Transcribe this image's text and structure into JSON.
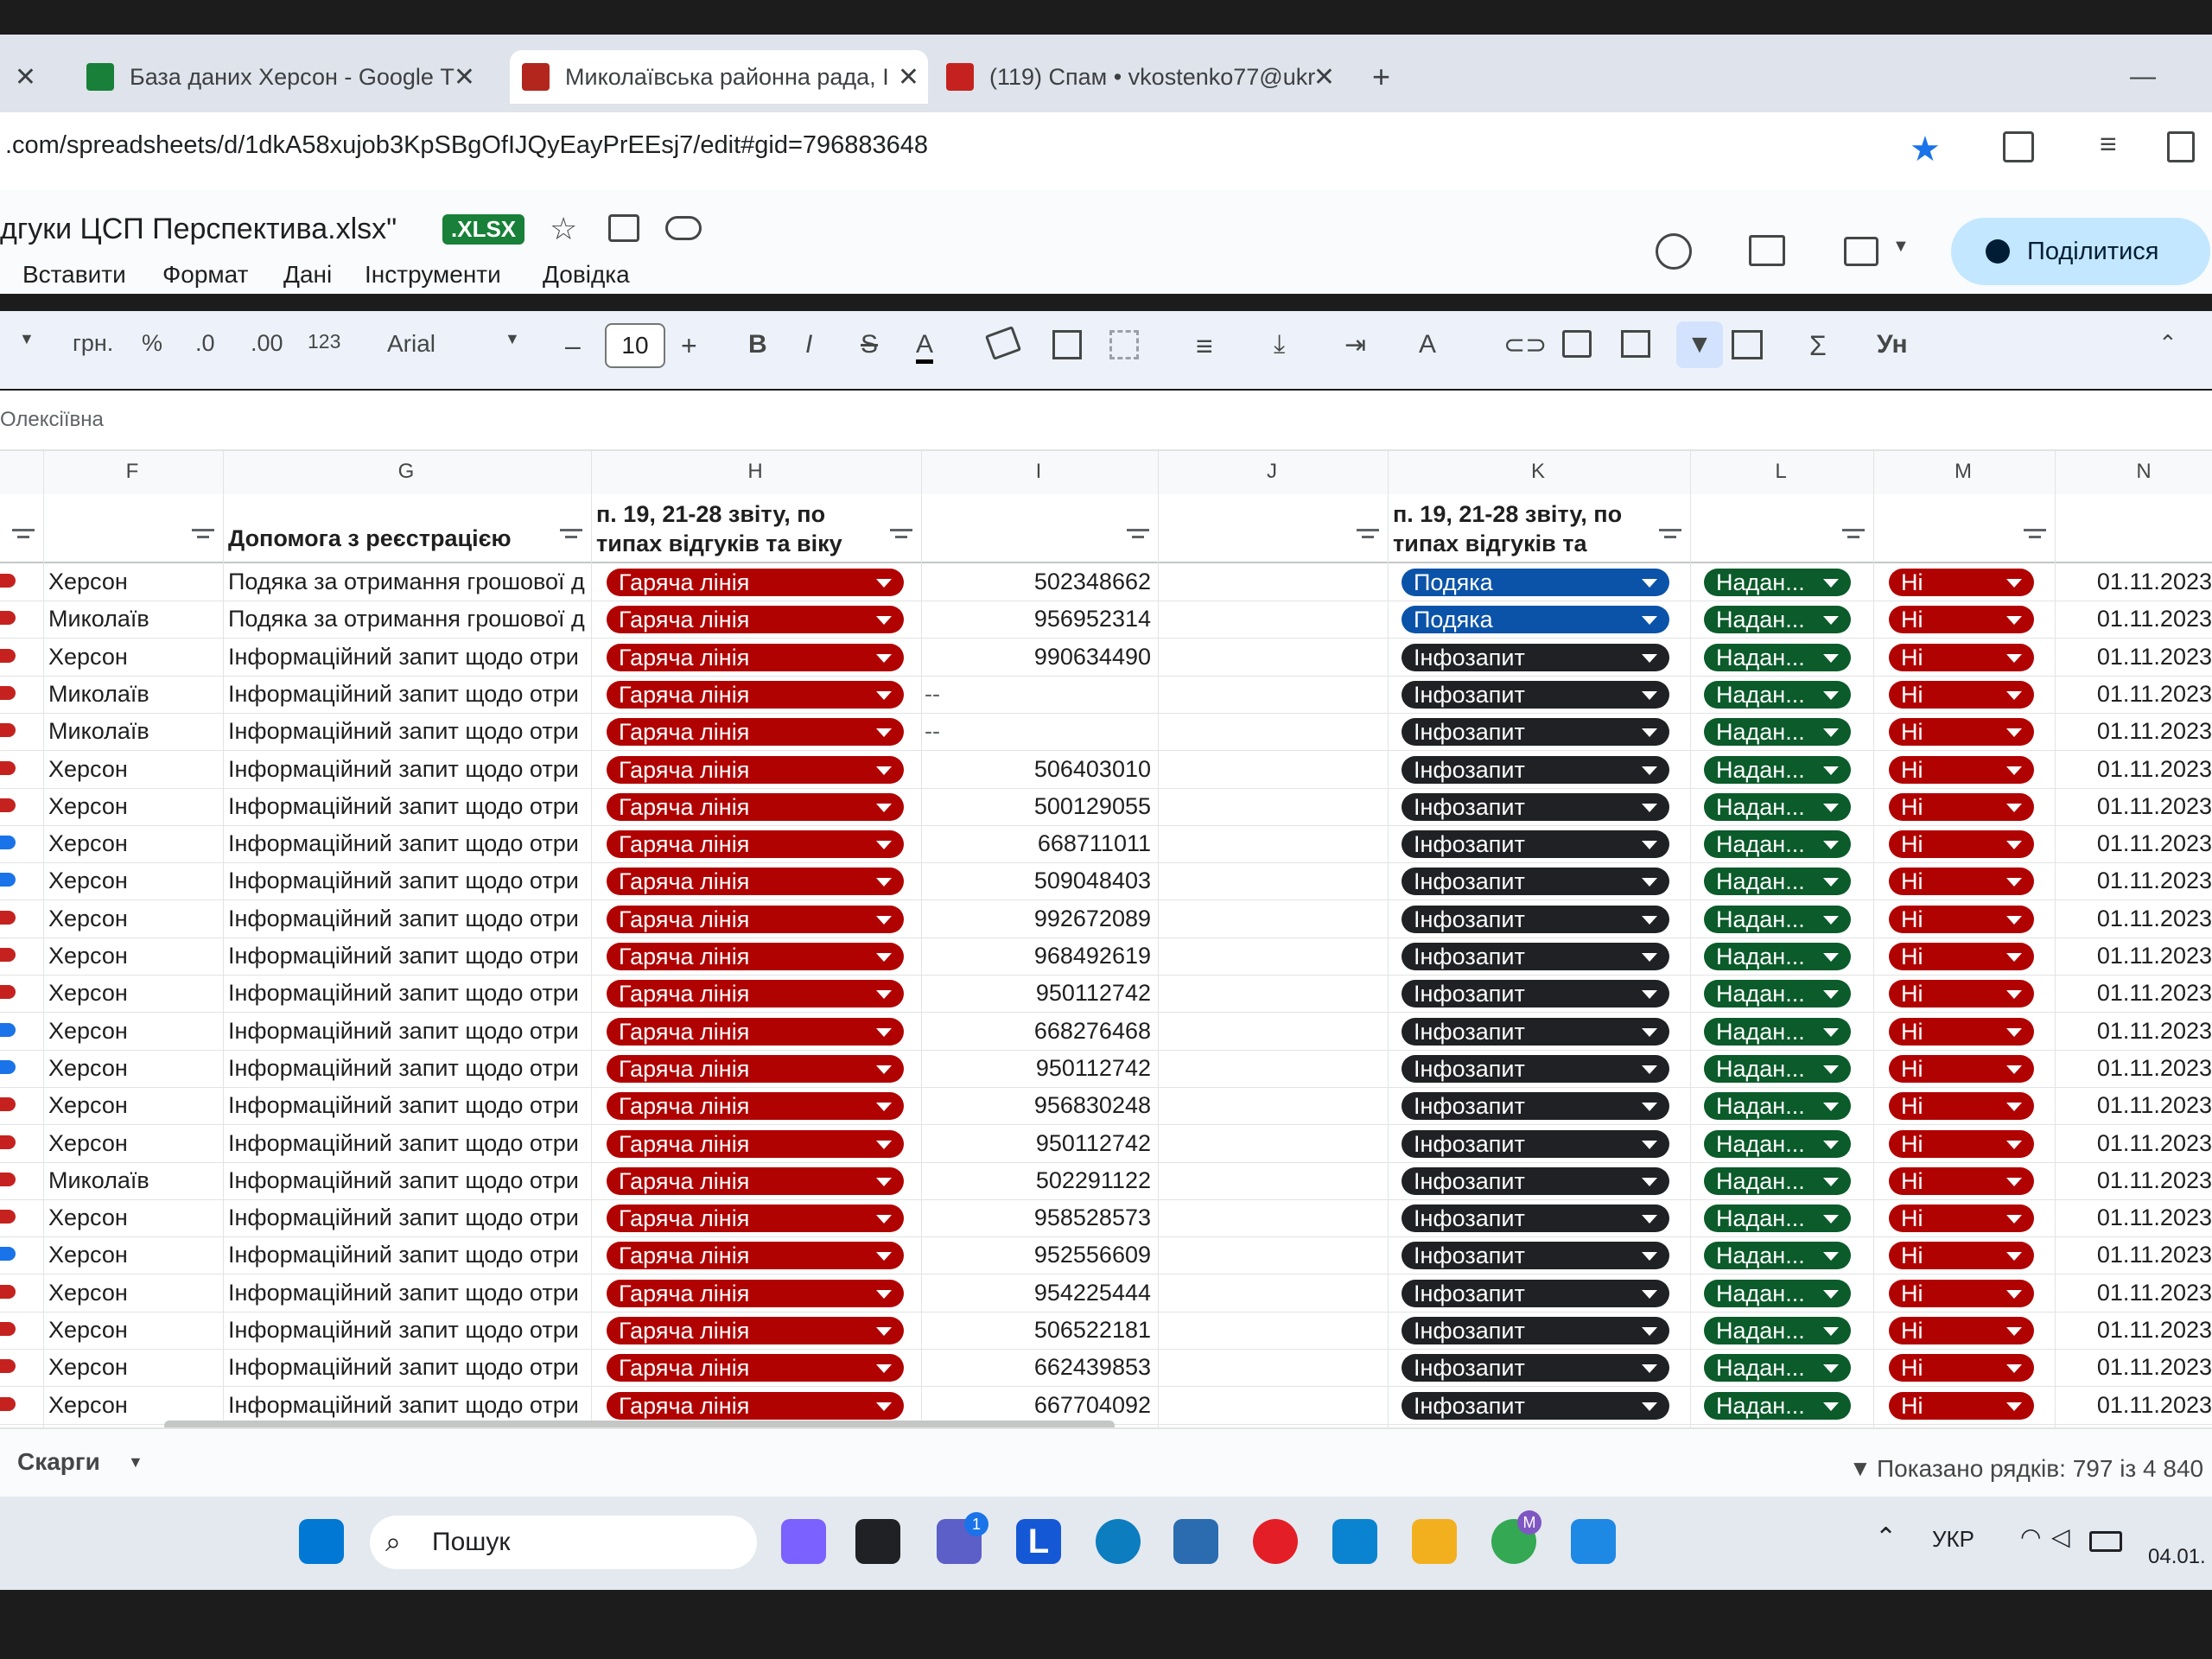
{
  "browser": {
    "tabs": [
      {
        "label": "База даних Херсон - Google Т",
        "favicon_color": "#188038"
      },
      {
        "label": "Миколаївська районна рада, І",
        "favicon_color": "#b3261e"
      },
      {
        "label": "(119) Спам • vkostenko77@ukr",
        "favicon_color": "#c5221f"
      }
    ],
    "new_tab": "+",
    "url": ".com/spreadsheets/d/1dkA58xujob3KpSBgOfIJQyEayPrEEsj7/edit#gid=796883648"
  },
  "doc": {
    "title": "дгуки ЦСП Перспектива.xlsx\"",
    "badge": ".XLSX",
    "menus": [
      "Вставити",
      "Формат",
      "Дані",
      "Інструменти",
      "Довідка"
    ],
    "share_label": "Поділитися"
  },
  "toolbar": {
    "currency": "грн.",
    "percent": "%",
    "dec_minus": ".0",
    "dec_plus": ".00",
    "number_fmt": "123",
    "font": "Arial",
    "font_size": "10",
    "minus": "–",
    "plus": "+",
    "bold": "B",
    "italic": "I",
    "strike": "S",
    "textcolor": "A",
    "sigma": "Σ",
    "input_tool": "Ун"
  },
  "formula_bar": {
    "value": "Олексіївна"
  },
  "columns": [
    "F",
    "G",
    "H",
    "I",
    "J",
    "K",
    "L",
    "M",
    "N"
  ],
  "header": {
    "g": "Допомога з реєстрацією",
    "h_line1": "п. 19, 21-28 звіту, по",
    "h_line2": "типах відгуків та віку",
    "k_line1": "п. 19, 21-28 звіту, по",
    "k_line2": "типах відгуків та"
  },
  "rows": [
    {
      "f": "Херсон",
      "g": "Подяка за отримання грошової д",
      "h": "Гаряча лінія",
      "i": "502348662",
      "j": "",
      "k": "Подяка",
      "k_color": "blue",
      "l": "Надан...",
      "m": "Ні",
      "n": "01.11.2023",
      "tag": "#c5221f"
    },
    {
      "f": "Миколаїв",
      "g": "Подяка за отримання грошової д",
      "h": "Гаряча лінія",
      "i": "956952314",
      "j": "",
      "k": "Подяка",
      "k_color": "blue",
      "l": "Надан...",
      "m": "Ні",
      "n": "01.11.2023",
      "tag": "#c5221f"
    },
    {
      "f": "Херсон",
      "g": "Інформаційний запит щодо отри",
      "h": "Гаряча лінія",
      "i": "990634490",
      "j": "",
      "k": "Інфозапит",
      "k_color": "black",
      "l": "Надан...",
      "m": "Ні",
      "n": "01.11.2023",
      "tag": "#c5221f"
    },
    {
      "f": "Миколаїв",
      "g": "Інформаційний запит щодо отри",
      "h": "Гаряча лінія",
      "i": "",
      "j": "--",
      "k": "Інфозапит",
      "k_color": "black",
      "l": "Надан...",
      "m": "Ні",
      "n": "01.11.2023",
      "tag": "#c5221f"
    },
    {
      "f": "Миколаїв",
      "g": "Інформаційний запит щодо отри",
      "h": "Гаряча лінія",
      "i": "",
      "j": "--",
      "k": "Інфозапит",
      "k_color": "black",
      "l": "Надан...",
      "m": "Ні",
      "n": "01.11.2023",
      "tag": "#c5221f"
    },
    {
      "f": "Херсон",
      "g": "Інформаційний запит щодо отри",
      "h": "Гаряча лінія",
      "i": "506403010",
      "j": "",
      "k": "Інфозапит",
      "k_color": "black",
      "l": "Надан...",
      "m": "Ні",
      "n": "01.11.2023",
      "tag": "#c5221f"
    },
    {
      "f": "Херсон",
      "g": "Інформаційний запит щодо отри",
      "h": "Гаряча лінія",
      "i": "500129055",
      "j": "",
      "k": "Інфозапит",
      "k_color": "black",
      "l": "Надан...",
      "m": "Ні",
      "n": "01.11.2023",
      "tag": "#c5221f"
    },
    {
      "f": "Херсон",
      "g": "Інформаційний запит щодо отри",
      "h": "Гаряча лінія",
      "i": "668711011",
      "j": "",
      "k": "Інфозапит",
      "k_color": "black",
      "l": "Надан...",
      "m": "Ні",
      "n": "01.11.2023",
      "tag": "#1a73e8"
    },
    {
      "f": "Херсон",
      "g": "Інформаційний запит щодо отри",
      "h": "Гаряча лінія",
      "i": "509048403",
      "j": "",
      "k": "Інфозапит",
      "k_color": "black",
      "l": "Надан...",
      "m": "Ні",
      "n": "01.11.2023",
      "tag": "#1a73e8"
    },
    {
      "f": "Херсон",
      "g": "Інформаційний запит щодо отри",
      "h": "Гаряча лінія",
      "i": "992672089",
      "j": "",
      "k": "Інфозапит",
      "k_color": "black",
      "l": "Надан...",
      "m": "Ні",
      "n": "01.11.2023",
      "tag": "#c5221f"
    },
    {
      "f": "Херсон",
      "g": "Інформаційний запит щодо отри",
      "h": "Гаряча лінія",
      "i": "968492619",
      "j": "",
      "k": "Інфозапит",
      "k_color": "black",
      "l": "Надан...",
      "m": "Ні",
      "n": "01.11.2023",
      "tag": "#c5221f"
    },
    {
      "f": "Херсон",
      "g": "Інформаційний запит щодо отри",
      "h": "Гаряча лінія",
      "i": "950112742",
      "j": "",
      "k": "Інфозапит",
      "k_color": "black",
      "l": "Надан...",
      "m": "Ні",
      "n": "01.11.2023",
      "tag": "#c5221f"
    },
    {
      "f": "Херсон",
      "g": "Інформаційний запит щодо отри",
      "h": "Гаряча лінія",
      "i": "668276468",
      "j": "",
      "k": "Інфозапит",
      "k_color": "black",
      "l": "Надан...",
      "m": "Ні",
      "n": "01.11.2023",
      "tag": "#1a73e8"
    },
    {
      "f": "Херсон",
      "g": "Інформаційний запит щодо отри",
      "h": "Гаряча лінія",
      "i": "950112742",
      "j": "",
      "k": "Інфозапит",
      "k_color": "black",
      "l": "Надан...",
      "m": "Ні",
      "n": "01.11.2023",
      "tag": "#1a73e8"
    },
    {
      "f": "Херсон",
      "g": "Інформаційний запит щодо отри",
      "h": "Гаряча лінія",
      "i": "956830248",
      "j": "",
      "k": "Інфозапит",
      "k_color": "black",
      "l": "Надан...",
      "m": "Ні",
      "n": "01.11.2023",
      "tag": "#c5221f"
    },
    {
      "f": "Херсон",
      "g": "Інформаційний запит щодо отри",
      "h": "Гаряча лінія",
      "i": "950112742",
      "j": "",
      "k": "Інфозапит",
      "k_color": "black",
      "l": "Надан...",
      "m": "Ні",
      "n": "01.11.2023",
      "tag": "#c5221f"
    },
    {
      "f": "Миколаїв",
      "g": "Інформаційний запит щодо отри",
      "h": "Гаряча лінія",
      "i": "502291122",
      "j": "",
      "k": "Інфозапит",
      "k_color": "black",
      "l": "Надан...",
      "m": "Ні",
      "n": "01.11.2023",
      "tag": "#c5221f"
    },
    {
      "f": "Херсон",
      "g": "Інформаційний запит щодо отри",
      "h": "Гаряча лінія",
      "i": "958528573",
      "j": "",
      "k": "Інфозапит",
      "k_color": "black",
      "l": "Надан...",
      "m": "Ні",
      "n": "01.11.2023",
      "tag": "#c5221f"
    },
    {
      "f": "Херсон",
      "g": "Інформаційний запит щодо отри",
      "h": "Гаряча лінія",
      "i": "952556609",
      "j": "",
      "k": "Інфозапит",
      "k_color": "black",
      "l": "Надан...",
      "m": "Ні",
      "n": "01.11.2023",
      "tag": "#1a73e8"
    },
    {
      "f": "Херсон",
      "g": "Інформаційний запит щодо отри",
      "h": "Гаряча лінія",
      "i": "954225444",
      "j": "",
      "k": "Інфозапит",
      "k_color": "black",
      "l": "Надан...",
      "m": "Ні",
      "n": "01.11.2023",
      "tag": "#c5221f"
    },
    {
      "f": "Херсон",
      "g": "Інформаційний запит щодо отри",
      "h": "Гаряча лінія",
      "i": "506522181",
      "j": "",
      "k": "Інфозапит",
      "k_color": "black",
      "l": "Надан...",
      "m": "Ні",
      "n": "01.11.2023",
      "tag": "#c5221f"
    },
    {
      "f": "Херсон",
      "g": "Інформаційний запит щодо отри",
      "h": "Гаряча лінія",
      "i": "662439853",
      "j": "",
      "k": "Інфозапит",
      "k_color": "black",
      "l": "Надан...",
      "m": "Ні",
      "n": "01.11.2023",
      "tag": "#c5221f"
    },
    {
      "f": "Херсон",
      "g": "Інформаційний запит щодо отри",
      "h": "Гаряча лінія",
      "i": "667704092",
      "j": "",
      "k": "Інфозапит",
      "k_color": "black",
      "l": "Надан...",
      "m": "Ні",
      "n": "01.11.2023",
      "tag": "#c5221f"
    }
  ],
  "sheet_tab": "Скарги",
  "status": "Показано рядків: 797 із 4 840",
  "taskbar": {
    "search_label": "Пошук",
    "lang": "УКР",
    "date": "04.01.",
    "chat_badge": "1",
    "chrome_badge": "M"
  },
  "colors": {
    "red_chip": "#b10202",
    "blue_chip": "#0a53a8",
    "black_chip": "#202124",
    "green_chip": "#0b5b2b",
    "share_bg": "#c2e7ff",
    "xlsx_badge": "#188038"
  }
}
